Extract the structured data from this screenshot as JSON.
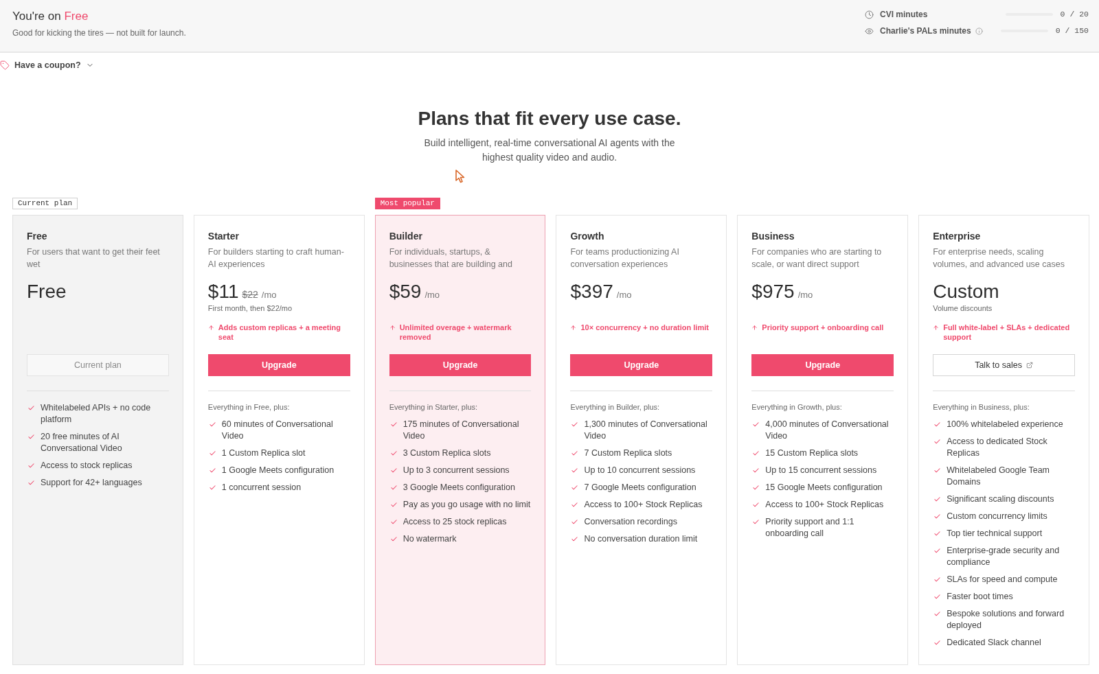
{
  "banner": {
    "title": "You're on",
    "plan": "Free",
    "tagline": "Good for kicking the tires — not built for launch."
  },
  "usage": [
    {
      "kind": "cvi",
      "label": "CVI minutes",
      "level": 0,
      "reading": "0 / 20"
    },
    {
      "kind": "pals",
      "label": "Charlie's PALs minutes",
      "level": 0,
      "reading": "0 / 150"
    }
  ],
  "coupon": {
    "label": "Have a coupon?",
    "expanded": false
  },
  "hero": {
    "title": "Plans that fit every use case.",
    "subtitle": "Build intelligent, real-time conversational AI agents with the highest quality video and audio."
  },
  "plans": [
    {
      "badge": {
        "label": "Current plan",
        "kind": "current"
      },
      "name": "Free",
      "description": "For users that want to get their feet wet",
      "price": "Free",
      "button": {
        "label": "Current plan",
        "kind": "current"
      },
      "features": [
        "Whitelabeled APIs + no code platform",
        "20 free minutes of AI Conversational Video",
        "Access to stock replicas",
        "Support for 42+ languages"
      ]
    },
    {
      "name": "Starter",
      "description": "For builders starting to craft human-AI experiences",
      "price": "$11",
      "compare_price": "$22",
      "period": "/mo",
      "price_note": "First month, then $22/mo",
      "highlight": "Adds custom replicas + a meeting seat",
      "button": {
        "label": "Upgrade",
        "kind": "upgrade"
      },
      "includes_heading": "Everything in Free, plus:",
      "features": [
        "60 minutes of Conversational Video",
        "1 Custom Replica slot",
        "1 Google Meets configuration",
        "1 concurrent session"
      ]
    },
    {
      "badge": {
        "label": "Most popular",
        "kind": "popular"
      },
      "name": "Builder",
      "description": "For individuals, startups, & businesses that are building and",
      "price": "$59",
      "period": "/mo",
      "highlight": "Unlimited overage + watermark removed",
      "button": {
        "label": "Upgrade",
        "kind": "upgrade"
      },
      "includes_heading": "Everything in Starter, plus:",
      "features": [
        "175 minutes of Conversational Video",
        "3 Custom Replica slots",
        "Up to 3 concurrent sessions",
        "3 Google Meets configuration",
        "Pay as you go usage with no limit",
        "Access to 25 stock replicas",
        "No watermark"
      ]
    },
    {
      "name": "Growth",
      "description": "For teams productionizing AI conversation experiences",
      "price": "$397",
      "period": "/mo",
      "highlight": "10× concurrency + no duration limit",
      "button": {
        "label": "Upgrade",
        "kind": "upgrade"
      },
      "includes_heading": "Everything in Builder, plus:",
      "features": [
        "1,300 minutes of Conversational Video",
        "7 Custom Replica slots",
        "Up to 10 concurrent sessions",
        "7 Google Meets configuration",
        "Access to 100+ Stock Replicas",
        "Conversation recordings",
        "No conversation duration limit"
      ]
    },
    {
      "name": "Business",
      "description": "For companies who are starting to scale, or want direct support",
      "price": "$975",
      "period": "/mo",
      "highlight": "Priority support + onboarding call",
      "button": {
        "label": "Upgrade",
        "kind": "upgrade"
      },
      "includes_heading": "Everything in Growth, plus:",
      "features": [
        "4,000 minutes of Conversational Video",
        "15 Custom Replica slots",
        "Up to 15 concurrent sessions",
        "15 Google Meets configuration",
        "Access to 100+ Stock Replicas",
        "Priority support and 1:1 onboarding call"
      ]
    },
    {
      "name": "Enterprise",
      "description": "For enterprise needs, scaling volumes, and advanced use cases",
      "price": "Custom",
      "price_note": "Volume discounts",
      "highlight": "Full white-label + SLAs + dedicated support",
      "button": {
        "label": "Talk to sales",
        "kind": "sales"
      },
      "includes_heading": "Everything in Business, plus:",
      "features": [
        "100% whitelabeled experience",
        "Access to dedicated Stock Replicas",
        "Whitelabeled Google Team Domains",
        "Significant scaling discounts",
        "Custom concurrency limits",
        "Top tier technical support",
        "Enterprise-grade security and compliance",
        "SLAs for speed and compute",
        "Faster boot times",
        "Bespoke solutions and forward deployed",
        "Dedicated Slack channel"
      ]
    }
  ]
}
